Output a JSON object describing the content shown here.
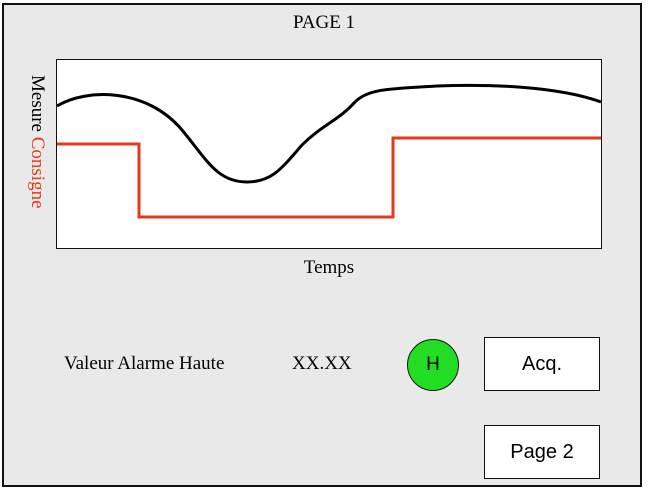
{
  "page": {
    "title": "PAGE 1"
  },
  "chart": {
    "y_label_mesure": "Mesure",
    "y_label_consigne": "Consigne",
    "x_label": "Temps",
    "colors": {
      "mesure": "#000000",
      "consigne": "#e23a1a"
    }
  },
  "alarm": {
    "label": "Valeur Alarme Haute",
    "value": "XX.XX",
    "indicator_text": "H",
    "indicator_color": "#22dd22"
  },
  "buttons": {
    "acq_label": "Acq.",
    "page2_label": "Page 2"
  }
}
